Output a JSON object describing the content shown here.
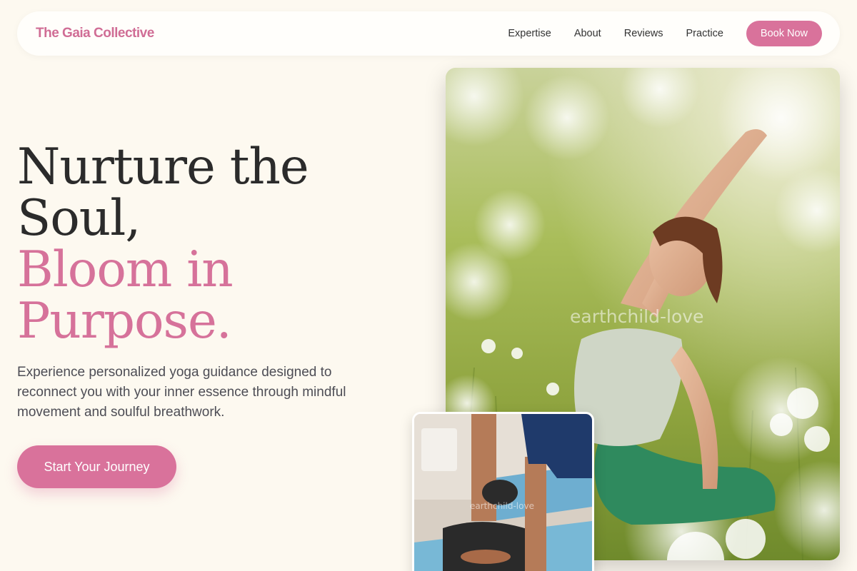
{
  "brand": {
    "name": "The Gaia Collective",
    "color": "#d06d95"
  },
  "nav": {
    "links": [
      "Expertise",
      "About",
      "Reviews",
      "Practice"
    ],
    "cta_label": "Book Now"
  },
  "hero": {
    "title_line1": "Nurture the",
    "title_line2": "Soul,",
    "title_accent_line1": "Bloom in",
    "title_accent_line2": "Purpose.",
    "subtitle": "Experience personalized yoga guidance designed to reconnect you with your inner essence through mindful movement and soulful breathwork.",
    "cta_label": "Start Your Journey"
  },
  "images": {
    "main_watermark": "earthchild-love",
    "small_watermark": "earthchild-love"
  },
  "colors": {
    "accent": "#d9729b",
    "background": "#fdf9f0"
  }
}
